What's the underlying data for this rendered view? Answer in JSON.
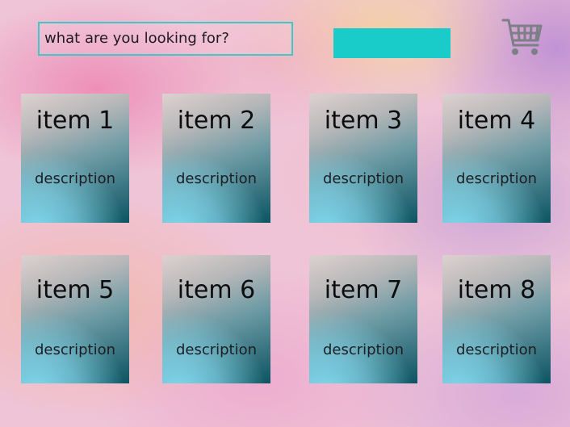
{
  "search": {
    "text": "what are you looking for?",
    "border_color": "#3cc9c8",
    "button_color": "#19cbc9"
  },
  "cart": {
    "icon": "shopping-cart-icon",
    "color": "#7c7f85"
  },
  "items": [
    {
      "title": "item 1",
      "description": "description"
    },
    {
      "title": "item 2",
      "description": "description"
    },
    {
      "title": "item 3",
      "description": "description"
    },
    {
      "title": "item 4",
      "description": "description"
    },
    {
      "title": "item 5",
      "description": "description"
    },
    {
      "title": "item 6",
      "description": "description"
    },
    {
      "title": "item 7",
      "description": "description"
    },
    {
      "title": "item 8",
      "description": "description"
    }
  ]
}
